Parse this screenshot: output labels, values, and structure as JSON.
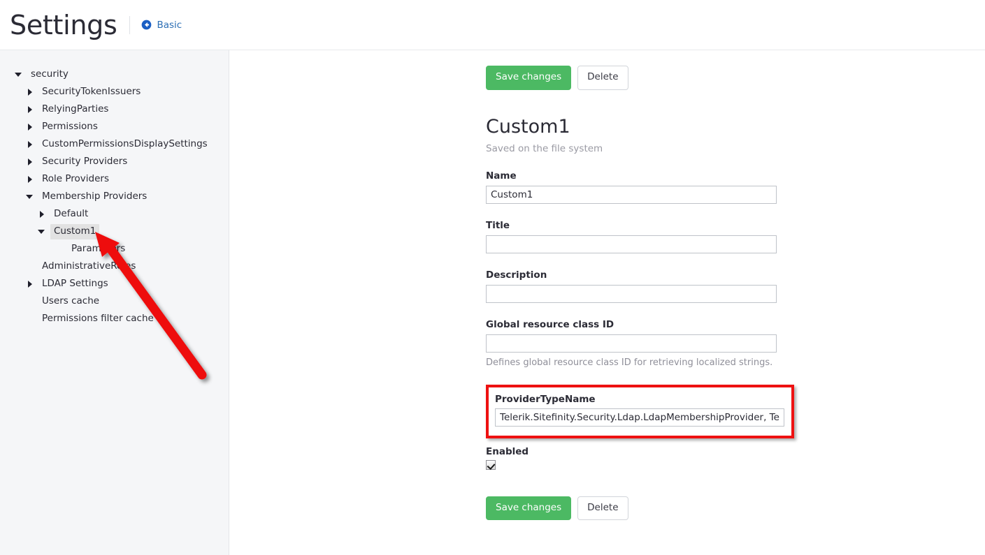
{
  "header": {
    "title": "Settings",
    "breadcrumb": {
      "label": "Basic",
      "icon": "back-circle-arrow-icon",
      "color": "#2c6fb5"
    }
  },
  "sidebar": {
    "items": [
      {
        "label": "security",
        "depth": 0,
        "toggle": "expanded",
        "selected": false
      },
      {
        "label": "SecurityTokenIssuers",
        "depth": 1,
        "toggle": "collapsed",
        "selected": false
      },
      {
        "label": "RelyingParties",
        "depth": 1,
        "toggle": "collapsed",
        "selected": false
      },
      {
        "label": "Permissions",
        "depth": 1,
        "toggle": "collapsed",
        "selected": false
      },
      {
        "label": "CustomPermissionsDisplaySettings",
        "depth": 1,
        "toggle": "collapsed",
        "selected": false
      },
      {
        "label": "Security Providers",
        "depth": 1,
        "toggle": "collapsed",
        "selected": false
      },
      {
        "label": "Role Providers",
        "depth": 1,
        "toggle": "collapsed",
        "selected": false
      },
      {
        "label": "Membership Providers",
        "depth": 1,
        "toggle": "expanded",
        "selected": false
      },
      {
        "label": "Default",
        "depth": 2,
        "toggle": "collapsed",
        "selected": false
      },
      {
        "label": "Custom1",
        "depth": 2,
        "toggle": "expanded",
        "selected": true
      },
      {
        "label": "Parameters",
        "depth": 3,
        "toggle": "none",
        "selected": false
      },
      {
        "label": "AdministrativeRoles",
        "depth": 1,
        "toggle": "none",
        "selected": false
      },
      {
        "label": "LDAP Settings",
        "depth": 1,
        "toggle": "collapsed",
        "selected": false
      },
      {
        "label": "Users cache",
        "depth": 1,
        "toggle": "none",
        "selected": false
      },
      {
        "label": "Permissions filter cache",
        "depth": 1,
        "toggle": "none",
        "selected": false
      }
    ]
  },
  "main": {
    "toolbar_top": {
      "save_label": "Save changes",
      "delete_label": "Delete"
    },
    "record": {
      "title": "Custom1",
      "subtitle": "Saved on the file system"
    },
    "fields": {
      "name": {
        "label": "Name",
        "value": "Custom1",
        "placeholder": ""
      },
      "title": {
        "label": "Title",
        "value": "",
        "placeholder": ""
      },
      "description": {
        "label": "Description",
        "value": "",
        "placeholder": ""
      },
      "global_resource_class_id": {
        "label": "Global resource class ID",
        "value": "",
        "placeholder": "",
        "hint": "Defines global resource class ID for retrieving localized strings."
      },
      "provider_type_name": {
        "label": "ProviderTypeName",
        "value": "Telerik.Sitefinity.Security.Ldap.LdapMembershipProvider, Telerik.Si",
        "placeholder": ""
      },
      "enabled": {
        "label": "Enabled",
        "checked": true
      }
    },
    "toolbar_bottom": {
      "save_label": "Save changes",
      "delete_label": "Delete"
    }
  },
  "annotations": {
    "highlight_color": "#ee1111",
    "arrow_color": "#ee1111",
    "arrow_target": "Custom1"
  },
  "colors": {
    "primary_button": "#4cb963",
    "sidebar_bg": "#f5f6f8",
    "link": "#2c6fb5",
    "text": "#2b2b35"
  }
}
